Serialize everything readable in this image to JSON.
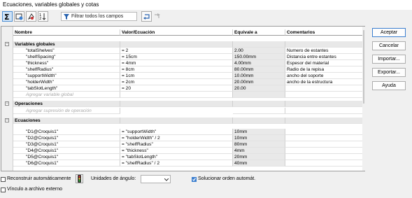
{
  "window": {
    "title": "Ecuaciones, variables globales y cotas"
  },
  "toolbar": {
    "filter_placeholder": "Filtrar todos los campos"
  },
  "table": {
    "headers": [
      "Nombre",
      "Valor/Ecuación",
      "Equivale a",
      "Comentarios"
    ],
    "sections": {
      "globals": "Variables globales",
      "features": "Operaciones",
      "equations": "Ecuaciones"
    },
    "globals": [
      {
        "name": "\"totalShelves\"",
        "value": "= 2",
        "equiv": "2.00",
        "comment": "Numero de estantes"
      },
      {
        "name": "\"shelfSpacing\"",
        "value": "= 15cm",
        "equiv": "150.00mm",
        "comment": "Distancia entre estantes"
      },
      {
        "name": "\"thickness\"",
        "value": "= 4mm",
        "equiv": "4.00mm",
        "comment": "Espesor del material"
      },
      {
        "name": "\"shelfRadius\"",
        "value": "= 8cm",
        "equiv": "80.00mm",
        "comment": "Radio de la repisa"
      },
      {
        "name": "\"supportWidth\"",
        "value": "= 1cm",
        "equiv": "10.00mm",
        "comment": "ancho del soporte"
      },
      {
        "name": "\"holderWidth\"",
        "value": "= 2cm",
        "equiv": "20.00mm",
        "comment": "ancho de la estructura"
      },
      {
        "name": "\"tabSlotLength\"",
        "value": "= 20",
        "equiv": "20.00",
        "comment": ""
      }
    ],
    "add_global": "Agregar variable global",
    "add_feature": "Agregar supresión de operación",
    "equations": [
      {
        "name": "\"D1@Croquis1\"",
        "value": "= \"supportWidth\"",
        "equiv": "10mm"
      },
      {
        "name": "\"D2@Croquis1\"",
        "value": "= \"holderWidth\" / 2",
        "equiv": "10mm"
      },
      {
        "name": "\"D3@Croquis1\"",
        "value": "= \"shelfRadius\"",
        "equiv": "80mm"
      },
      {
        "name": "\"D4@Croquis1\"",
        "value": "= \"thickness\"",
        "equiv": "4mm"
      },
      {
        "name": "\"D5@Croquis1\"",
        "value": "= \"tabSlotLength\"",
        "equiv": "20mm"
      },
      {
        "name": "\"D6@Croquis1\"",
        "value": "= \"shelfRadius\" / 2",
        "equiv": "40mm"
      }
    ]
  },
  "buttons": {
    "ok": "Aceptar",
    "cancel": "Cancelar",
    "import": "Importar...",
    "export": "Exportar...",
    "help": "Ayuda"
  },
  "bottom": {
    "auto_rebuild": "Reconstruir automáticamente",
    "angle_units": "Unidades de ángulo:",
    "angle_units_value": "",
    "solve_order": "Solucionar orden automát.",
    "link_external": "Vínculo a archivo externo"
  }
}
